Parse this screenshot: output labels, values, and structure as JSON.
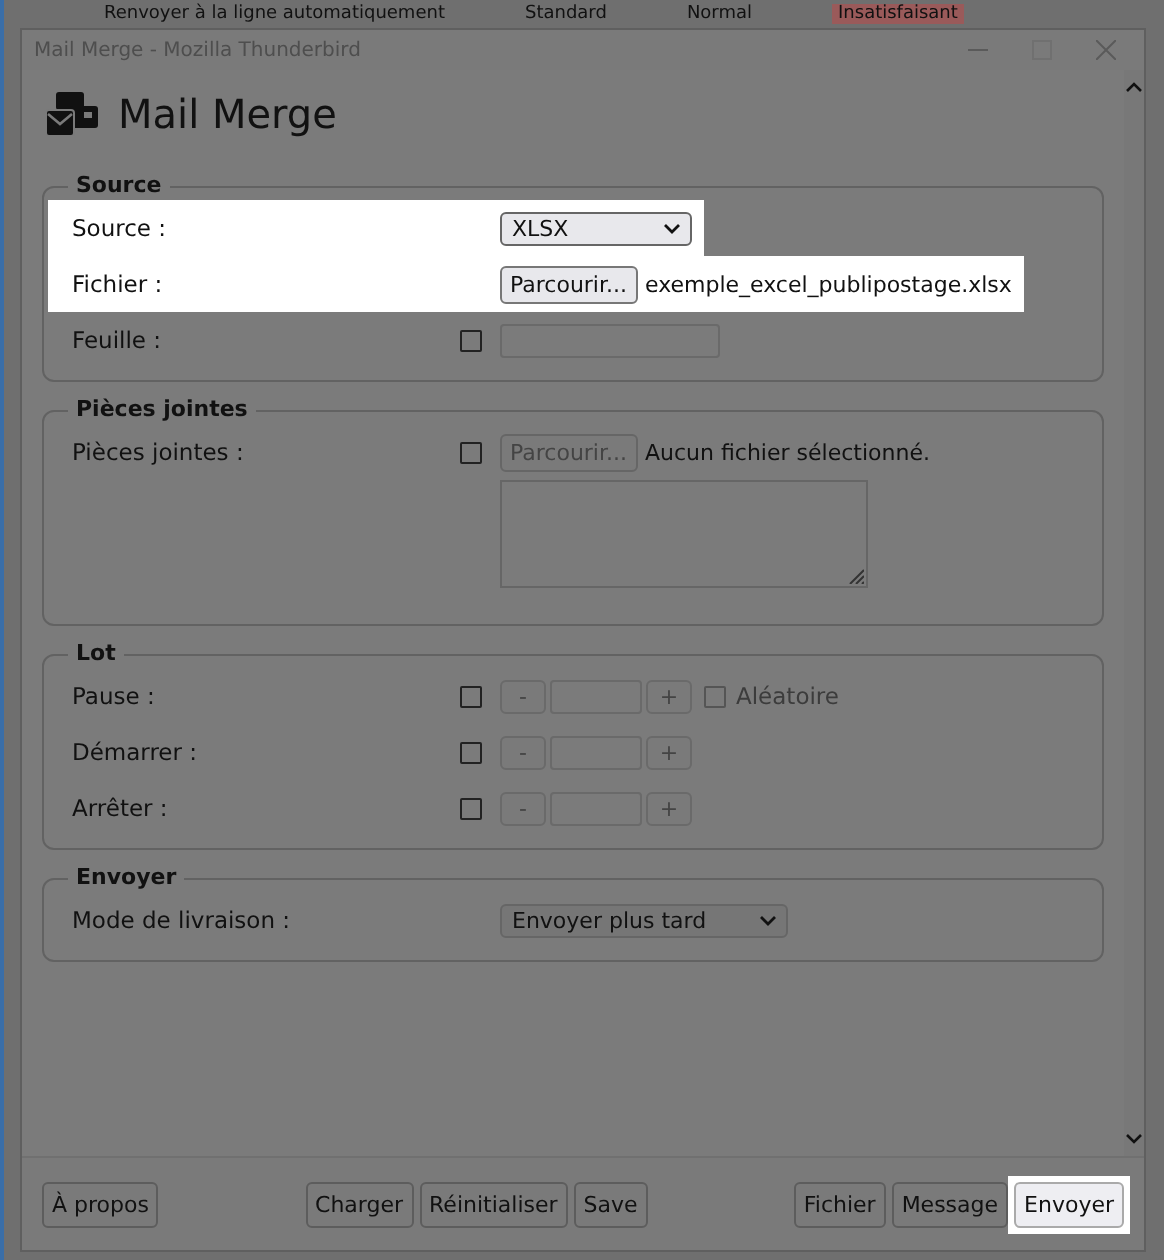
{
  "background_strip": [
    "Renvoyer à la ligne automatiquement",
    "Standard",
    "Normal",
    "Insatisfaisant"
  ],
  "window": {
    "title": "Mail Merge - Mozilla Thunderbird"
  },
  "header": {
    "title": "Mail Merge"
  },
  "sections": [
    {
      "legend": "Source",
      "rows": [
        {
          "kind": "select",
          "label": "Source :",
          "highlighted": true,
          "value": "XLSX"
        },
        {
          "kind": "file",
          "label": "Fichier :",
          "highlighted": true,
          "button": "Parcourir...",
          "file_name": "exemple_excel_publipostage.xlsx",
          "disabled": false
        },
        {
          "kind": "text",
          "label": "Feuille :",
          "highlighted": false,
          "checked": false
        }
      ]
    },
    {
      "legend": "Pièces jointes",
      "rows": [
        {
          "kind": "file",
          "label": "Pièces jointes :",
          "highlighted": false,
          "checked": false,
          "button": "Parcourir...",
          "file_name": "Aucun fichier sélectionné.",
          "disabled": true
        },
        {
          "kind": "textarea",
          "highlighted": false
        }
      ]
    },
    {
      "legend": "Lot",
      "rows": [
        {
          "kind": "spinner",
          "label": "Pause :",
          "highlighted": false,
          "checked": false,
          "minus": "-",
          "plus": "+",
          "extra": {
            "label": "Aléatoire",
            "checked": false
          }
        },
        {
          "kind": "spinner",
          "label": "Démarrer :",
          "highlighted": false,
          "checked": false,
          "minus": "-",
          "plus": "+"
        },
        {
          "kind": "spinner",
          "label": "Arrêter :",
          "highlighted": false,
          "checked": false,
          "minus": "-",
          "plus": "+"
        }
      ]
    },
    {
      "legend": "Envoyer",
      "rows": [
        {
          "kind": "select",
          "label": "Mode de livraison :",
          "highlighted": false,
          "value": "Envoyer plus tard"
        }
      ]
    }
  ],
  "footer": {
    "left": [
      {
        "label": "À propos",
        "highlighted": false
      }
    ],
    "center": [
      {
        "label": "Charger",
        "highlighted": false
      },
      {
        "label": "Réinitialiser",
        "highlighted": false
      },
      {
        "label": "Save",
        "highlighted": false
      }
    ],
    "right": [
      {
        "label": "Fichier",
        "highlighted": false
      },
      {
        "label": "Message",
        "highlighted": false
      },
      {
        "label": "Envoyer",
        "highlighted": true
      }
    ]
  }
}
